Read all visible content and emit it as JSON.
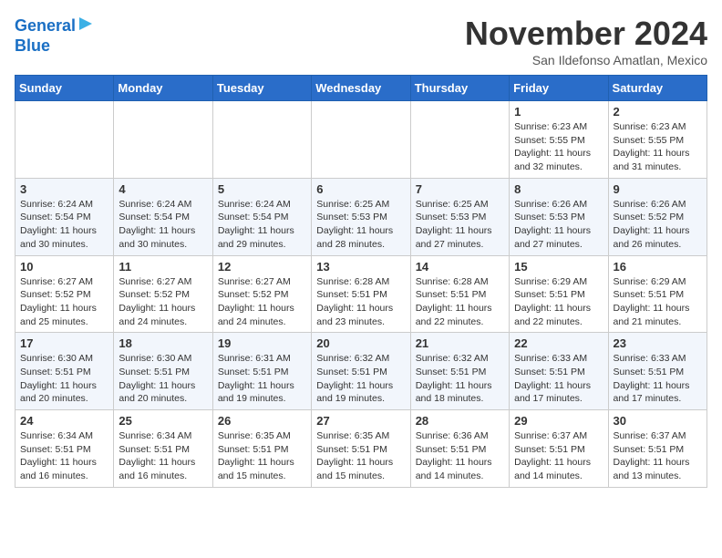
{
  "header": {
    "logo": {
      "line1": "General",
      "line2": "Blue"
    },
    "month": "November 2024",
    "location": "San Ildefonso Amatlan, Mexico"
  },
  "weekdays": [
    "Sunday",
    "Monday",
    "Tuesday",
    "Wednesday",
    "Thursday",
    "Friday",
    "Saturday"
  ],
  "weeks": [
    [
      {
        "day": "",
        "info": ""
      },
      {
        "day": "",
        "info": ""
      },
      {
        "day": "",
        "info": ""
      },
      {
        "day": "",
        "info": ""
      },
      {
        "day": "",
        "info": ""
      },
      {
        "day": "1",
        "info": "Sunrise: 6:23 AM\nSunset: 5:55 PM\nDaylight: 11 hours\nand 32 minutes."
      },
      {
        "day": "2",
        "info": "Sunrise: 6:23 AM\nSunset: 5:55 PM\nDaylight: 11 hours\nand 31 minutes."
      }
    ],
    [
      {
        "day": "3",
        "info": "Sunrise: 6:24 AM\nSunset: 5:54 PM\nDaylight: 11 hours\nand 30 minutes."
      },
      {
        "day": "4",
        "info": "Sunrise: 6:24 AM\nSunset: 5:54 PM\nDaylight: 11 hours\nand 30 minutes."
      },
      {
        "day": "5",
        "info": "Sunrise: 6:24 AM\nSunset: 5:54 PM\nDaylight: 11 hours\nand 29 minutes."
      },
      {
        "day": "6",
        "info": "Sunrise: 6:25 AM\nSunset: 5:53 PM\nDaylight: 11 hours\nand 28 minutes."
      },
      {
        "day": "7",
        "info": "Sunrise: 6:25 AM\nSunset: 5:53 PM\nDaylight: 11 hours\nand 27 minutes."
      },
      {
        "day": "8",
        "info": "Sunrise: 6:26 AM\nSunset: 5:53 PM\nDaylight: 11 hours\nand 27 minutes."
      },
      {
        "day": "9",
        "info": "Sunrise: 6:26 AM\nSunset: 5:52 PM\nDaylight: 11 hours\nand 26 minutes."
      }
    ],
    [
      {
        "day": "10",
        "info": "Sunrise: 6:27 AM\nSunset: 5:52 PM\nDaylight: 11 hours\nand 25 minutes."
      },
      {
        "day": "11",
        "info": "Sunrise: 6:27 AM\nSunset: 5:52 PM\nDaylight: 11 hours\nand 24 minutes."
      },
      {
        "day": "12",
        "info": "Sunrise: 6:27 AM\nSunset: 5:52 PM\nDaylight: 11 hours\nand 24 minutes."
      },
      {
        "day": "13",
        "info": "Sunrise: 6:28 AM\nSunset: 5:51 PM\nDaylight: 11 hours\nand 23 minutes."
      },
      {
        "day": "14",
        "info": "Sunrise: 6:28 AM\nSunset: 5:51 PM\nDaylight: 11 hours\nand 22 minutes."
      },
      {
        "day": "15",
        "info": "Sunrise: 6:29 AM\nSunset: 5:51 PM\nDaylight: 11 hours\nand 22 minutes."
      },
      {
        "day": "16",
        "info": "Sunrise: 6:29 AM\nSunset: 5:51 PM\nDaylight: 11 hours\nand 21 minutes."
      }
    ],
    [
      {
        "day": "17",
        "info": "Sunrise: 6:30 AM\nSunset: 5:51 PM\nDaylight: 11 hours\nand 20 minutes."
      },
      {
        "day": "18",
        "info": "Sunrise: 6:30 AM\nSunset: 5:51 PM\nDaylight: 11 hours\nand 20 minutes."
      },
      {
        "day": "19",
        "info": "Sunrise: 6:31 AM\nSunset: 5:51 PM\nDaylight: 11 hours\nand 19 minutes."
      },
      {
        "day": "20",
        "info": "Sunrise: 6:32 AM\nSunset: 5:51 PM\nDaylight: 11 hours\nand 19 minutes."
      },
      {
        "day": "21",
        "info": "Sunrise: 6:32 AM\nSunset: 5:51 PM\nDaylight: 11 hours\nand 18 minutes."
      },
      {
        "day": "22",
        "info": "Sunrise: 6:33 AM\nSunset: 5:51 PM\nDaylight: 11 hours\nand 17 minutes."
      },
      {
        "day": "23",
        "info": "Sunrise: 6:33 AM\nSunset: 5:51 PM\nDaylight: 11 hours\nand 17 minutes."
      }
    ],
    [
      {
        "day": "24",
        "info": "Sunrise: 6:34 AM\nSunset: 5:51 PM\nDaylight: 11 hours\nand 16 minutes."
      },
      {
        "day": "25",
        "info": "Sunrise: 6:34 AM\nSunset: 5:51 PM\nDaylight: 11 hours\nand 16 minutes."
      },
      {
        "day": "26",
        "info": "Sunrise: 6:35 AM\nSunset: 5:51 PM\nDaylight: 11 hours\nand 15 minutes."
      },
      {
        "day": "27",
        "info": "Sunrise: 6:35 AM\nSunset: 5:51 PM\nDaylight: 11 hours\nand 15 minutes."
      },
      {
        "day": "28",
        "info": "Sunrise: 6:36 AM\nSunset: 5:51 PM\nDaylight: 11 hours\nand 14 minutes."
      },
      {
        "day": "29",
        "info": "Sunrise: 6:37 AM\nSunset: 5:51 PM\nDaylight: 11 hours\nand 14 minutes."
      },
      {
        "day": "30",
        "info": "Sunrise: 6:37 AM\nSunset: 5:51 PM\nDaylight: 11 hours\nand 13 minutes."
      }
    ]
  ]
}
